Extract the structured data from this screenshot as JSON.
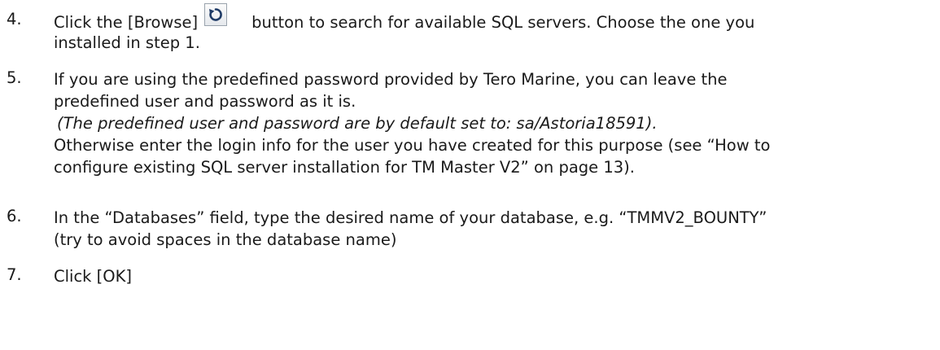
{
  "items": [
    {
      "number": "4.",
      "before_button": "Click the [Browse]",
      "after_button": "button to search for available SQL servers. Choose the one you",
      "continuation": "installed in step 1."
    },
    {
      "number": "5.",
      "lines": [
        "If you are using the predefined password provided by Tero Marine, you can leave the",
        "predefined user and password as it is."
      ],
      "italic_note": "(The predefined user and password are by default set to: sa/Astoria18591).",
      "more_lines": [
        "Otherwise enter the login info for the user you have created for this purpose (see “How to",
        "configure existing SQL server installation for TM Master V2” on page 13)."
      ]
    },
    {
      "number": "6.",
      "lines": [
        "In the “Databases” field, type the desired name of your database, e.g. “TMMV2_BOUNTY”",
        "(try to avoid spaces in the database name)"
      ]
    },
    {
      "number": "7.",
      "lines": [
        "Click [OK]"
      ]
    }
  ],
  "icons": {
    "browse_button": "refresh-icon",
    "accent_color": "#1f3b66"
  }
}
